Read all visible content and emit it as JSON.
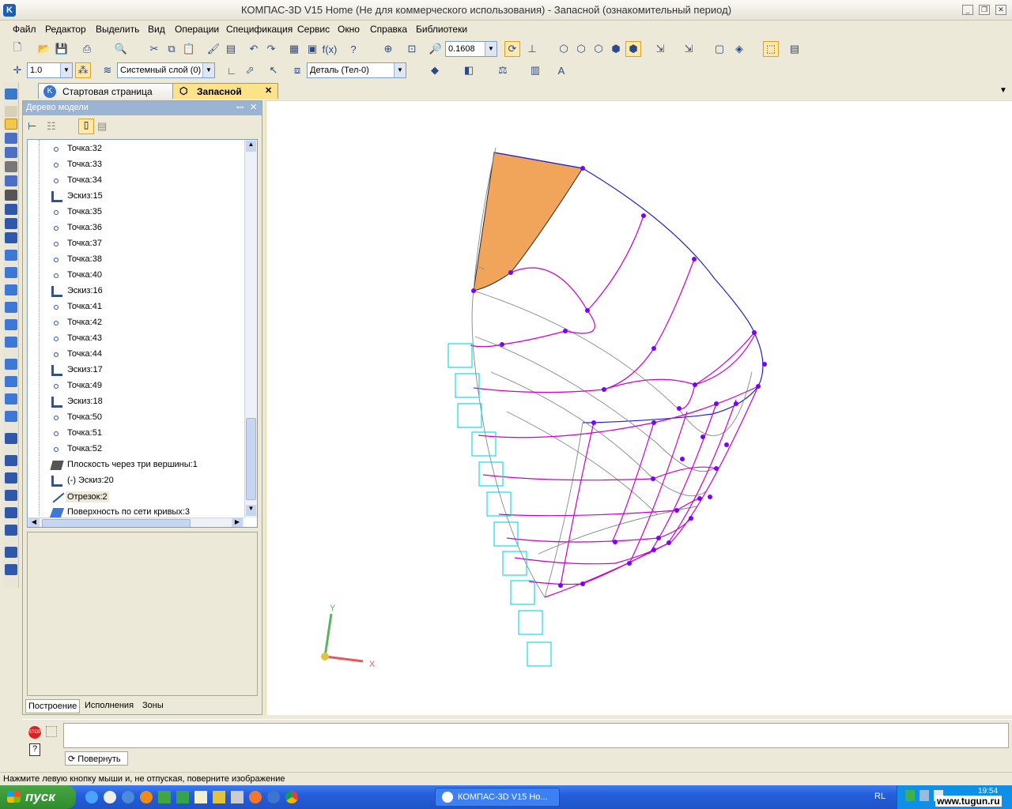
{
  "window": {
    "app_icon": "K",
    "title": "КОМПАС-3D V15 Home (Не для коммерческого использования) - Запасной (ознакомительный период)",
    "min": "_",
    "max": "❐",
    "close": "✕"
  },
  "menu": [
    "Файл",
    "Редактор",
    "Выделить",
    "Вид",
    "Операции",
    "Спецификация",
    "Сервис",
    "Окно",
    "Справка",
    "Библиотеки"
  ],
  "toolbar": {
    "zoom_value": "0.1608",
    "step_value": "1.0",
    "layer_value": "Системный слой (0)",
    "part_value": "Деталь (Тел-0)"
  },
  "tabs": {
    "start_page": "Стартовая страница",
    "document": "Запасной"
  },
  "tree_panel": {
    "title": "Дерево модели",
    "pin": "ꟷ",
    "close": "✕",
    "items": [
      {
        "icon": "point",
        "label": "Точка:32"
      },
      {
        "icon": "point",
        "label": "Точка:33"
      },
      {
        "icon": "point",
        "label": "Точка:34"
      },
      {
        "icon": "sketch",
        "label": "Эскиз:15"
      },
      {
        "icon": "point",
        "label": "Точка:35"
      },
      {
        "icon": "point",
        "label": "Точка:36"
      },
      {
        "icon": "point",
        "label": "Точка:37"
      },
      {
        "icon": "point",
        "label": "Точка:38"
      },
      {
        "icon": "point",
        "label": "Точка:40"
      },
      {
        "icon": "sketch",
        "label": "Эскиз:16"
      },
      {
        "icon": "point",
        "label": "Точка:41"
      },
      {
        "icon": "point",
        "label": "Точка:42"
      },
      {
        "icon": "point",
        "label": "Точка:43"
      },
      {
        "icon": "point",
        "label": "Точка:44"
      },
      {
        "icon": "sketch",
        "label": "Эскиз:17"
      },
      {
        "icon": "point",
        "label": "Точка:49"
      },
      {
        "icon": "sketch",
        "label": "Эскиз:18"
      },
      {
        "icon": "point",
        "label": "Точка:50"
      },
      {
        "icon": "point",
        "label": "Точка:51"
      },
      {
        "icon": "point",
        "label": "Точка:52"
      },
      {
        "icon": "plane",
        "label": "Плоскость через три вершины:1"
      },
      {
        "icon": "sketch",
        "label": "(-) Эскиз:20"
      },
      {
        "icon": "segment",
        "label": "Отрезок:2"
      },
      {
        "icon": "surface",
        "label": "Поверхность по сети кривых:3"
      }
    ],
    "bottom_tabs": [
      "Построение",
      "Исполнения",
      "Зоны"
    ]
  },
  "viewport": {
    "axis_x": "X",
    "axis_y": "Y"
  },
  "command_panel": {
    "rotate_button": "Повернуть"
  },
  "status_text": "Нажмите левую кнопку мыши и, не отпуская, поверните изображение",
  "taskbar": {
    "start": "пуск",
    "task": "КОМПАС-3D V15 Ho...",
    "lang": "RL",
    "clock": "19:54",
    "watermark": "www.tugun.ru"
  },
  "colors": {
    "curve_magenta": "#cc00cc",
    "point_violet": "#7a00ff",
    "edge_blue": "#1f1fcf",
    "surface_orange": "#f0a55a",
    "frame_cyan": "#00d8e8"
  }
}
